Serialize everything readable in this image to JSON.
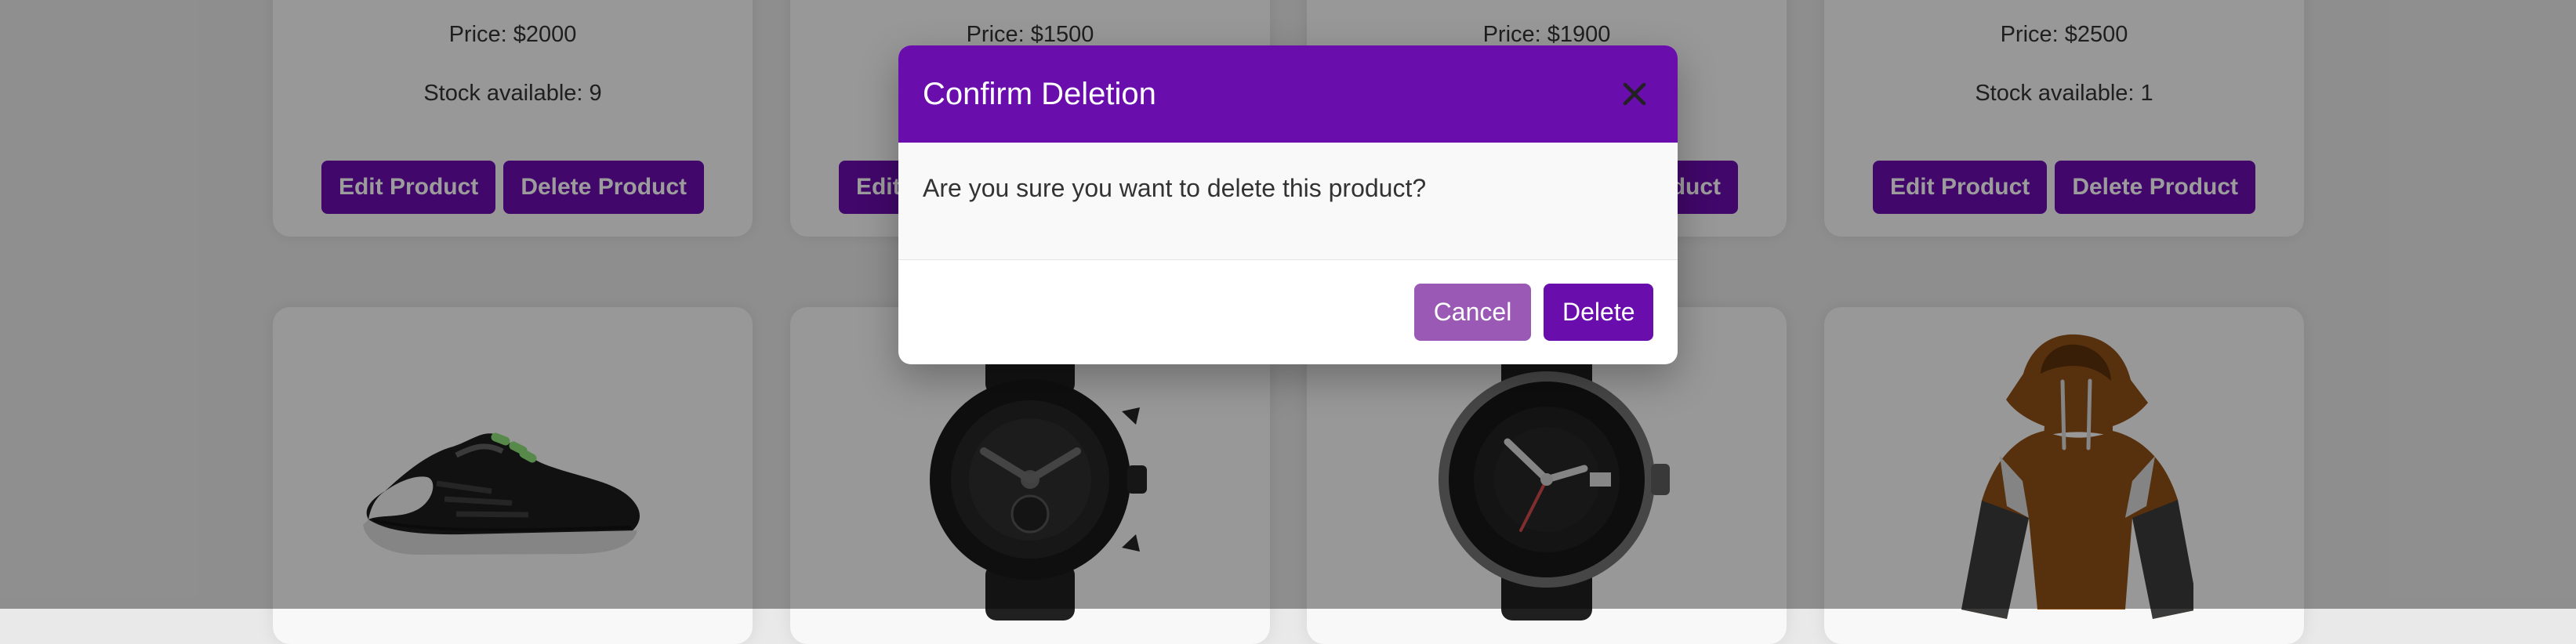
{
  "products": {
    "top_row": [
      {
        "price": "Price: $2000",
        "stock": "Stock available: 9"
      },
      {
        "price": "Price: $1500",
        "stock": ""
      },
      {
        "price": "Price: $1900",
        "stock": ""
      },
      {
        "price": "Price: $2500",
        "stock": "Stock available: 1"
      }
    ],
    "buttons": {
      "edit": "Edit Product",
      "delete": "Delete Product"
    },
    "bottom_images": [
      "sneaker-image",
      "watch-image",
      "dive-watch-image",
      "hoodie-image"
    ]
  },
  "modal": {
    "title": "Confirm Deletion",
    "message": "Are you sure you want to delete this product?",
    "cancel_label": "Cancel",
    "delete_label": "Delete"
  },
  "colors": {
    "accent": "#6a0dad",
    "cancel": "#9b59b6",
    "overlay": "rgba(0,0,0,0.39)"
  }
}
